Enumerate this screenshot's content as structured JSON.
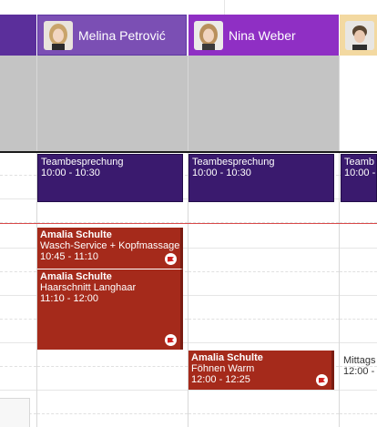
{
  "colors": {
    "purple_header": "#7b4fb4",
    "magenta_header": "#8f2fc4",
    "meeting": "#3a1a6e",
    "appointment": "#a52a1b",
    "now_line": "#d94a4a",
    "blocked": "#c4c4c4"
  },
  "staff": [
    {
      "name": "Melina Petrović",
      "avatar_icon": "staff-photo-icon"
    },
    {
      "name": "Nina Weber",
      "avatar_icon": "staff-photo-icon"
    },
    {
      "name": "",
      "avatar_icon": "staff-photo-icon"
    }
  ],
  "events": {
    "melina_meeting": {
      "title": "Teambesprechung",
      "time": "10:00 - 10:30"
    },
    "nina_meeting": {
      "title": "Teambesprechung",
      "time": "10:00 - 10:30"
    },
    "third_meeting": {
      "title": "Teamb",
      "time": "10:00 -"
    },
    "melina_appt1": {
      "client": "Amalia Schulte",
      "service": "Wasch-Service + Kopfmassage",
      "time": "10:45 - 11:10"
    },
    "melina_appt2": {
      "client": "Amalia Schulte",
      "service": "Haarschnitt Langhaar",
      "time": "11:10 - 12:00"
    },
    "nina_appt1": {
      "client": "Amalia Schulte",
      "service": "Föhnen Warm",
      "time": "12:00 - 12:25"
    },
    "third_break": {
      "title": "Mittags",
      "time": "12:00 -"
    }
  }
}
